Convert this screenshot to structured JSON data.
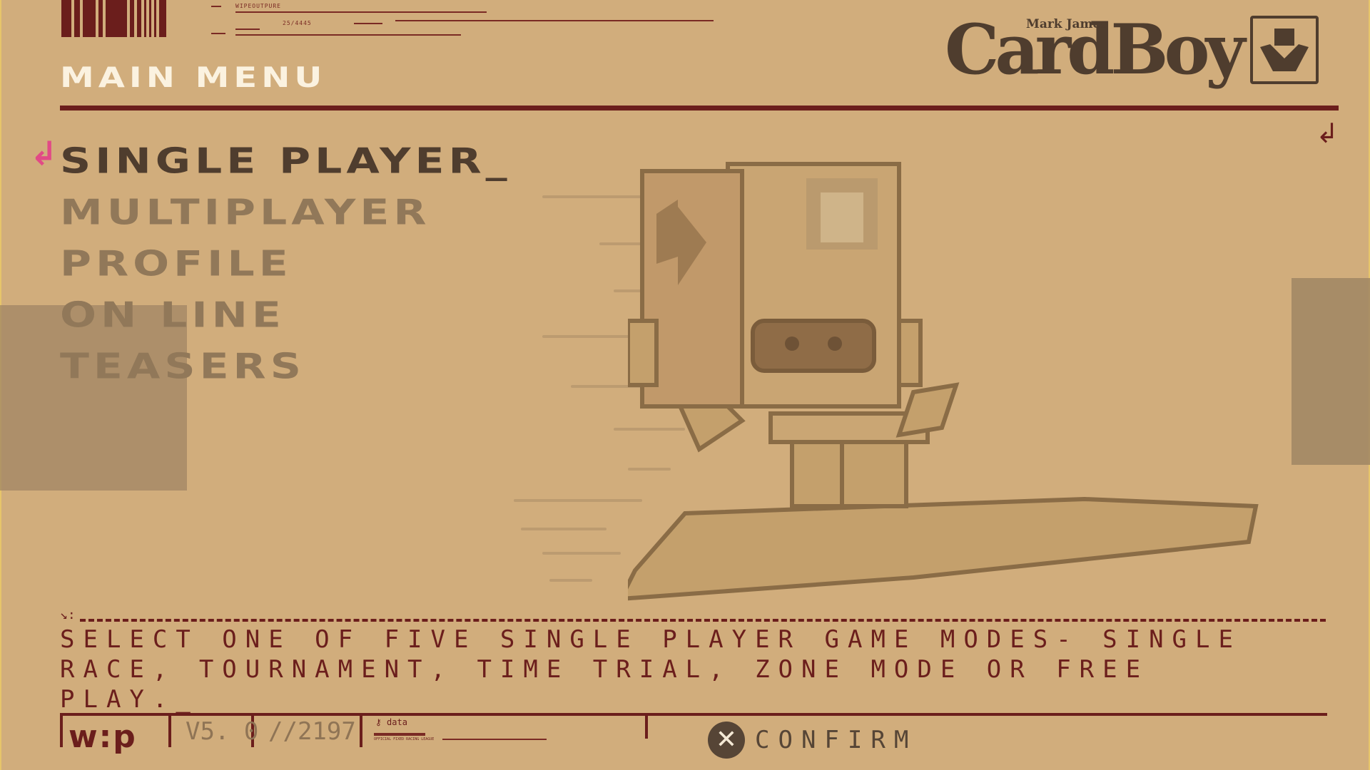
{
  "header": {
    "title": "Main Menu",
    "tech_text_1": "WIPEOUTPURE",
    "tech_text_2": "25/4445"
  },
  "logo": {
    "brand": "CardBoy",
    "small_text": "Mark James"
  },
  "menu": {
    "items": [
      {
        "label": "Single Player_",
        "selected": true
      },
      {
        "label": "Multiplayer",
        "selected": false
      },
      {
        "label": "Profile",
        "selected": false
      },
      {
        "label": "On Line",
        "selected": false
      },
      {
        "label": "Teasers",
        "selected": false
      }
    ]
  },
  "description": {
    "text": "SELECT ONE OF FIVE SINGLE PLAYER GAME MODES- SINGLE RACE, TOURNAMENT, TIME TRIAL, ZONE MODE OR FREE PLAY._"
  },
  "footer": {
    "wip_logo": "w:p",
    "version": "V5. 0",
    "build": "//2197",
    "data_label": "data",
    "data_sub": "OFFICIAL FIXED RACING LEAGUE",
    "confirm_label": "CONFIRM"
  },
  "colors": {
    "background": "#d1ad7c",
    "accent_dark_red": "#6b1e1c",
    "cursor_pink": "#e24a86",
    "title_white": "#fbf2e0",
    "selected_text": "#4f3d2e",
    "dim_text": "#917859"
  },
  "icons": {
    "cursor": "down-left-arrow-icon",
    "corner": "down-left-arrow-icon",
    "confirm": "cross-button-icon"
  }
}
